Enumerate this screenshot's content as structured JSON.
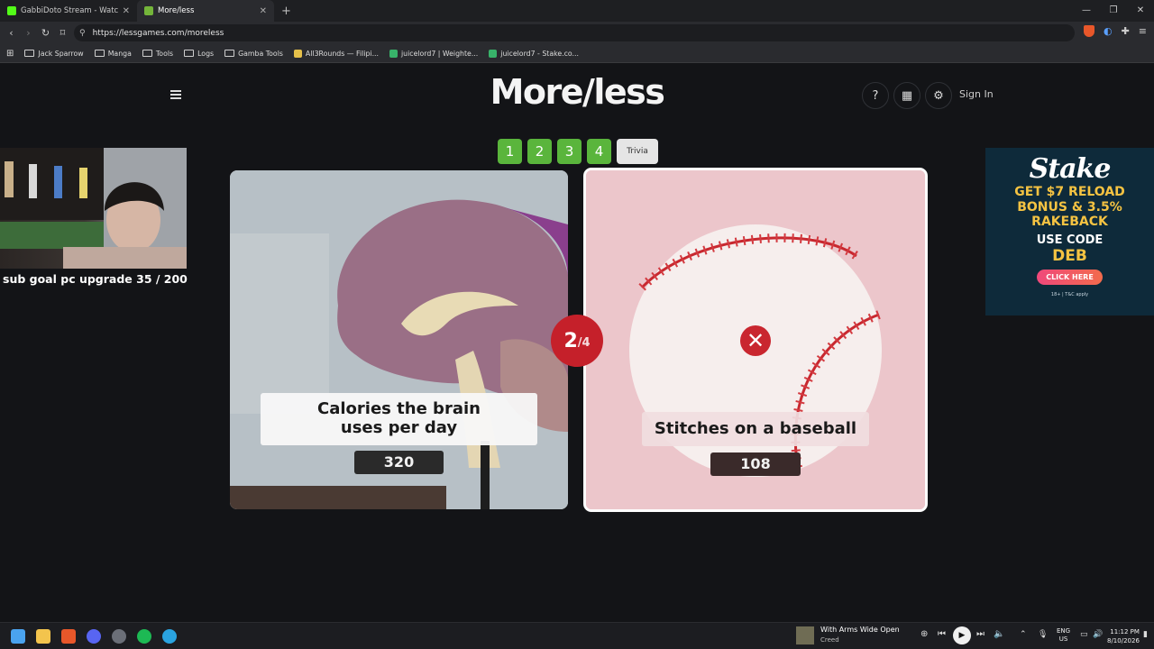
{
  "browser": {
    "tabs": [
      {
        "title": "GabbiDoto Stream - Watch Live o",
        "favicon_color": "#53fc18"
      },
      {
        "title": "More/less",
        "favicon_color": "#74b53a",
        "active": true
      }
    ],
    "new_tab": "+",
    "window_controls": [
      "—",
      "❐",
      "✕"
    ],
    "url": "https://lessgames.com/moreless",
    "bookmarks": [
      {
        "label": "Jack Sparrow",
        "type": "folder"
      },
      {
        "label": "Manga",
        "type": "folder"
      },
      {
        "label": "Tools",
        "type": "folder"
      },
      {
        "label": "Logs",
        "type": "folder"
      },
      {
        "label": "Gamba Tools",
        "type": "folder"
      },
      {
        "label": "All3Rounds — Filipi...",
        "type": "link",
        "color": "#e5c04a"
      },
      {
        "label": "juicelord7 | Weighte...",
        "type": "link",
        "color": "#38b36a"
      },
      {
        "label": "juicelord7 - Stake.co...",
        "type": "link",
        "color": "#38b36a"
      }
    ]
  },
  "site": {
    "logo": "More/less",
    "help_glyph": "?",
    "sign_in": "Sign In",
    "round_tabs": [
      "1",
      "2",
      "3",
      "4",
      "Trivia"
    ],
    "left_card": {
      "label_line1": "Calories the brain",
      "label_line2": "uses per day",
      "value": "320"
    },
    "right_card": {
      "label": "Stitches on a baseball",
      "value": "108"
    },
    "progress": {
      "current": "2",
      "total": "/4"
    },
    "wrong_mark": "✕"
  },
  "overlay": {
    "stream_goal": "sub goal pc upgrade 35 / 200",
    "ad": {
      "brand": "Stake",
      "line1": "GET $7 RELOAD",
      "line2": "BONUS & 3.5%",
      "line3": "RAKEBACK",
      "use_code": "USE CODE",
      "code": "DEB",
      "button": "CLICK HERE",
      "fine_print": "18+ | T&C apply"
    }
  },
  "taskbar": {
    "now_playing": {
      "title": "With Arms Wide Open",
      "artist": "Creed"
    },
    "language": {
      "line1": "ENG",
      "line2": "US"
    },
    "time": "11:12 PM",
    "date": "8/10/2026"
  },
  "colors": {
    "page_bg": "#131417",
    "round_tab_green": "#5ab53c",
    "badge_red": "#c5202a",
    "ad_bg": "#0e2a3a",
    "ad_gold": "#f5c342"
  }
}
